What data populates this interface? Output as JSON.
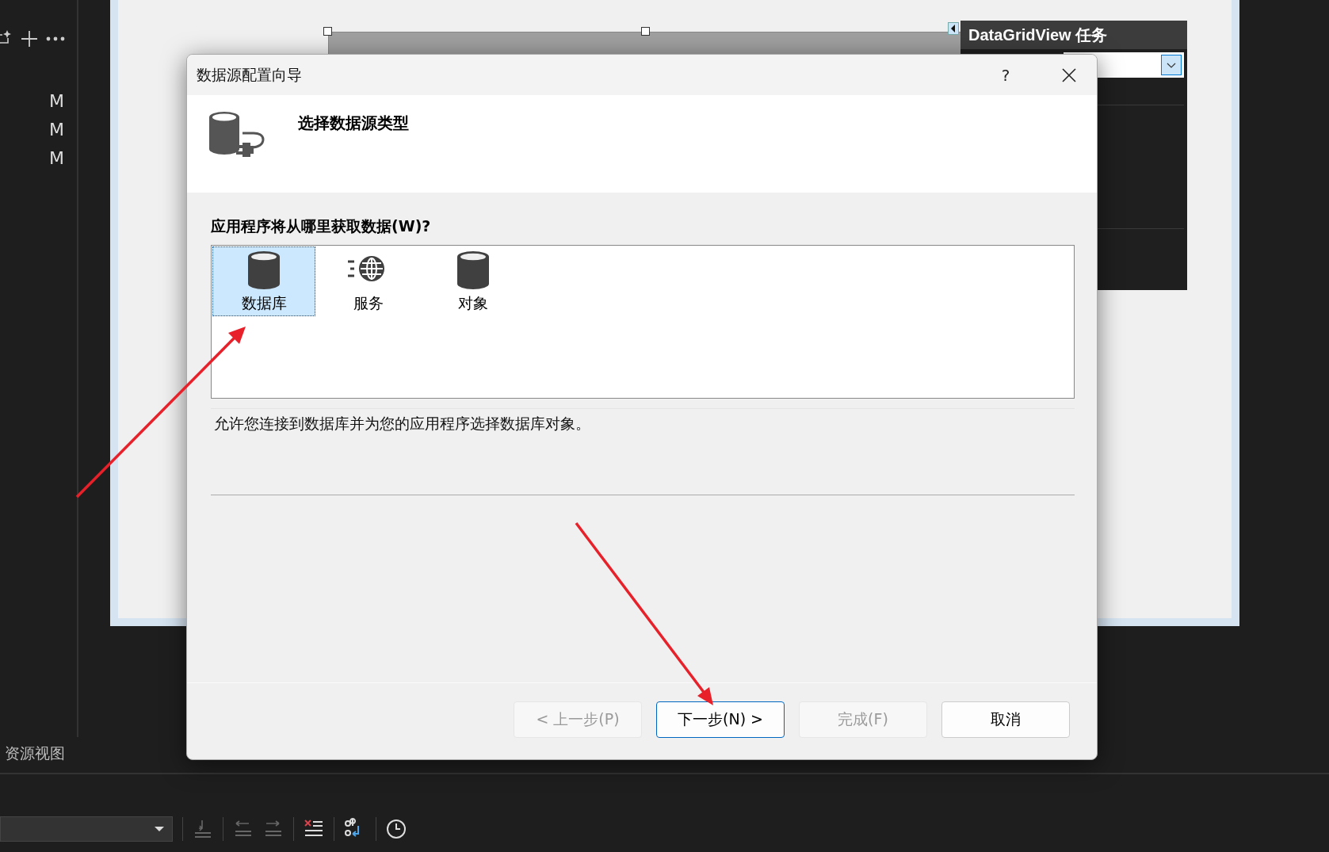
{
  "ide": {
    "sidebar_badges": [
      "M",
      "M",
      "M"
    ],
    "sidebar_tab": "资源视图"
  },
  "smart_tag_panel": {
    "title": "DataGridView 任务"
  },
  "dialog": {
    "title": "数据源配置向导",
    "help": "?",
    "header": "选择数据源类型",
    "question": "应用程序将从哪里获取数据(W)?",
    "options": [
      {
        "label": "数据库",
        "kind": "database",
        "selected": true
      },
      {
        "label": "服务",
        "kind": "service",
        "selected": false
      },
      {
        "label": "对象",
        "kind": "object",
        "selected": false
      }
    ],
    "description": "允许您连接到数据库并为您的应用程序选择数据库对象。",
    "buttons": [
      {
        "label": "< 上一步(P)",
        "disabled": true,
        "default": false
      },
      {
        "label": "下一步(N) >",
        "disabled": false,
        "default": true
      },
      {
        "label": "完成(F)",
        "disabled": true,
        "default": false
      },
      {
        "label": "取消",
        "disabled": false,
        "default": false
      }
    ]
  }
}
